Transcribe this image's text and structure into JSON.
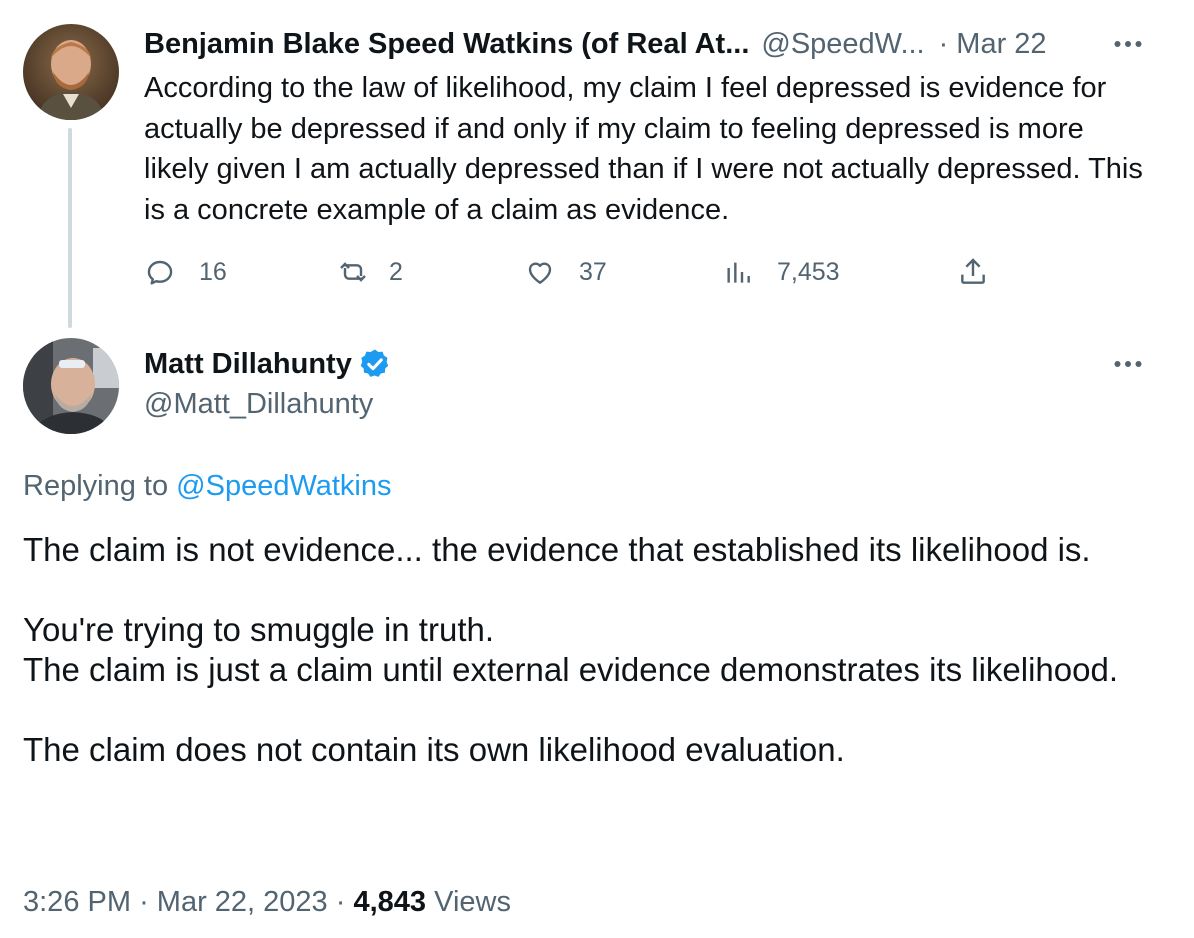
{
  "parent": {
    "name": "Benjamin Blake Speed Watkins (of Real At...",
    "handle": "@SpeedW...",
    "separator": "·",
    "date": "Mar 22",
    "text": "According to the law of likelihood, my claim I feel depressed is evidence for actually be depressed if and only if my claim to feeling depressed is more likely given I am actually depressed than if I were not actually depressed. This is a concrete example of a claim as evidence.",
    "actions": {
      "replies": "16",
      "retweets": "2",
      "likes": "37",
      "views": "7,453"
    },
    "icons": {
      "more": "more-icon",
      "reply": "reply-icon",
      "retweet": "retweet-icon",
      "like": "like-icon",
      "views": "views-icon",
      "share": "share-icon"
    }
  },
  "reply": {
    "name": "Matt Dillahunty",
    "handle": "@Matt_Dillahunty",
    "verified_icon": "verified-badge-icon",
    "replying_prefix": "Replying to",
    "replying_to": "@SpeedWatkins",
    "paragraphs": [
      "The claim is not evidence... the evidence that established its likelihood is.",
      "You're trying to smuggle in truth.\nThe claim is just a claim until external evidence demonstrates its likelihood.",
      "The claim does not contain its own likelihood evaluation."
    ],
    "footer": {
      "time": "3:26 PM",
      "separator": "·",
      "date": "Mar 22, 2023",
      "views_count": "4,843",
      "views_label": "Views"
    }
  },
  "colors": {
    "text_primary": "#0f1419",
    "text_secondary": "#536471",
    "link": "#1d9bf0",
    "thread_line": "#cfd9de",
    "verified": "#1d9bf0"
  }
}
